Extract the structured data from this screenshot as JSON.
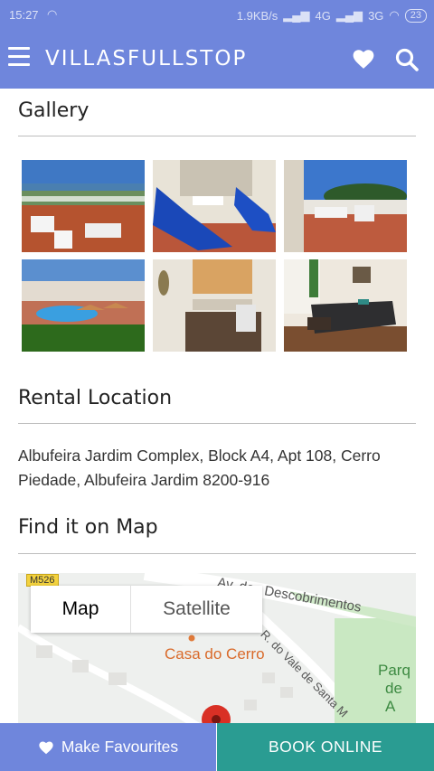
{
  "status_bar": {
    "time": "15:27",
    "net_speed": "1.9KB/s",
    "network_1": "4G",
    "network_2": "3G",
    "battery": "23"
  },
  "header": {
    "brand": "VILLASFULLSTOP",
    "bg_color": "#6f86dc"
  },
  "gallery": {
    "title": "Gallery",
    "images": [
      {
        "name": "terrace-sea-view"
      },
      {
        "name": "terrace-blue-loungers"
      },
      {
        "name": "terrace-table-trees"
      },
      {
        "name": "pool-complex"
      },
      {
        "name": "kitchen"
      },
      {
        "name": "living-room-sofa"
      }
    ]
  },
  "location": {
    "title": "Rental Location",
    "address": "Albufeira Jardim Complex, Block A4, Apt 108, Cerro Piedade, Albufeira Jardim 8200-916"
  },
  "map": {
    "title": "Find it on Map",
    "toggle_map": "Map",
    "toggle_satellite": "Satellite",
    "road_badge": "M526",
    "street_1": "Av. dos Descobrimentos",
    "street_2": "R. do Vale de Santa M",
    "place": "Casa do Cerro",
    "park": "Parq",
    "park_2": "de A"
  },
  "bottom_bar": {
    "favourites": "Make Favourites",
    "book": "BOOK ONLINE",
    "fav_color": "#6f86dc",
    "book_color": "#2a9c92"
  }
}
